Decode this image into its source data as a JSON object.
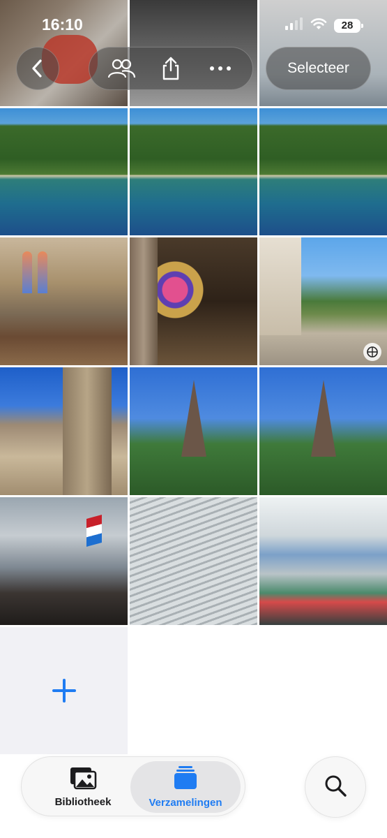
{
  "status_bar": {
    "time": "16:10",
    "battery": "28"
  },
  "toolbar": {
    "back_icon": "chevron-left-icon",
    "share_people_icon": "people-icon",
    "share_icon": "share-icon",
    "more_icon": "ellipsis-icon",
    "select_label": "Selecteer"
  },
  "photos": [
    {
      "name": "photo-lake-1",
      "kind": "lake"
    },
    {
      "name": "photo-lake-2",
      "kind": "lake"
    },
    {
      "name": "photo-lake-3",
      "kind": "lake"
    },
    {
      "name": "photo-church-interior",
      "kind": "church"
    },
    {
      "name": "photo-rose-window-organ",
      "kind": "organ"
    },
    {
      "name": "photo-street-flag",
      "kind": "street"
    },
    {
      "name": "photo-cathedral-tower",
      "kind": "cathedral"
    },
    {
      "name": "photo-spire-1",
      "kind": "spire"
    },
    {
      "name": "photo-spire-2",
      "kind": "spire"
    },
    {
      "name": "photo-flag-church",
      "kind": "flag"
    },
    {
      "name": "photo-station-roof",
      "kind": "roof"
    },
    {
      "name": "photo-station-escalator",
      "kind": "station"
    }
  ],
  "add_cell": {
    "icon": "plus-icon"
  },
  "tabs": {
    "library_label": "Bibliotheek",
    "collections_label": "Verzamelingen"
  },
  "colors": {
    "accent": "#1f7cf2",
    "tab_bar_bg": "#f7f7f7",
    "selected_tab_bg": "#e4e4e6"
  }
}
